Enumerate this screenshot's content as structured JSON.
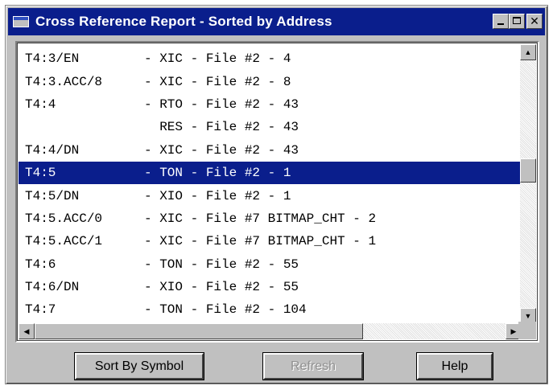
{
  "window": {
    "title": "Cross Reference Report - Sorted by Address"
  },
  "rows": [
    {
      "address": "T4:3/EN",
      "ref": "- XIC - File #2 - 4",
      "selected": false
    },
    {
      "address": "T4:3.ACC/8",
      "ref": "- XIC - File #2 - 8",
      "selected": false
    },
    {
      "address": "T4:4",
      "ref": "- RTO - File #2 - 43",
      "selected": false
    },
    {
      "address": "",
      "ref": "  RES - File #2 - 43",
      "selected": false
    },
    {
      "address": "T4:4/DN",
      "ref": "- XIC - File #2 - 43",
      "selected": false
    },
    {
      "address": "T4:5",
      "ref": "- TON - File #2 - 1",
      "selected": true
    },
    {
      "address": "T4:5/DN",
      "ref": "- XIO - File #2 - 1",
      "selected": false
    },
    {
      "address": "T4:5.ACC/0",
      "ref": "- XIC - File #7 BITMAP_CHT - 2",
      "selected": false
    },
    {
      "address": "T4:5.ACC/1",
      "ref": "- XIC - File #7 BITMAP_CHT - 1",
      "selected": false
    },
    {
      "address": "T4:6",
      "ref": "- TON - File #2 - 55",
      "selected": false
    },
    {
      "address": "T4:6/DN",
      "ref": "- XIO - File #2 - 55",
      "selected": false
    },
    {
      "address": "T4:7",
      "ref": "- TON - File #2 - 104",
      "selected": false
    }
  ],
  "buttons": {
    "sort": "Sort By Symbol",
    "refresh": "Refresh",
    "help": "Help"
  },
  "icons": {
    "app": "app-window-icon",
    "minimize": "minimize-icon",
    "maximize": "maximize-icon",
    "close": "close-icon",
    "scroll_up": "arrow-up-icon",
    "scroll_down": "arrow-down-icon",
    "scroll_left": "arrow-left-icon",
    "scroll_right": "arrow-right-icon"
  },
  "colors": {
    "titlebar": "#0a1e8c",
    "selection": "#0a1e8c",
    "face": "#c0c0c0"
  }
}
